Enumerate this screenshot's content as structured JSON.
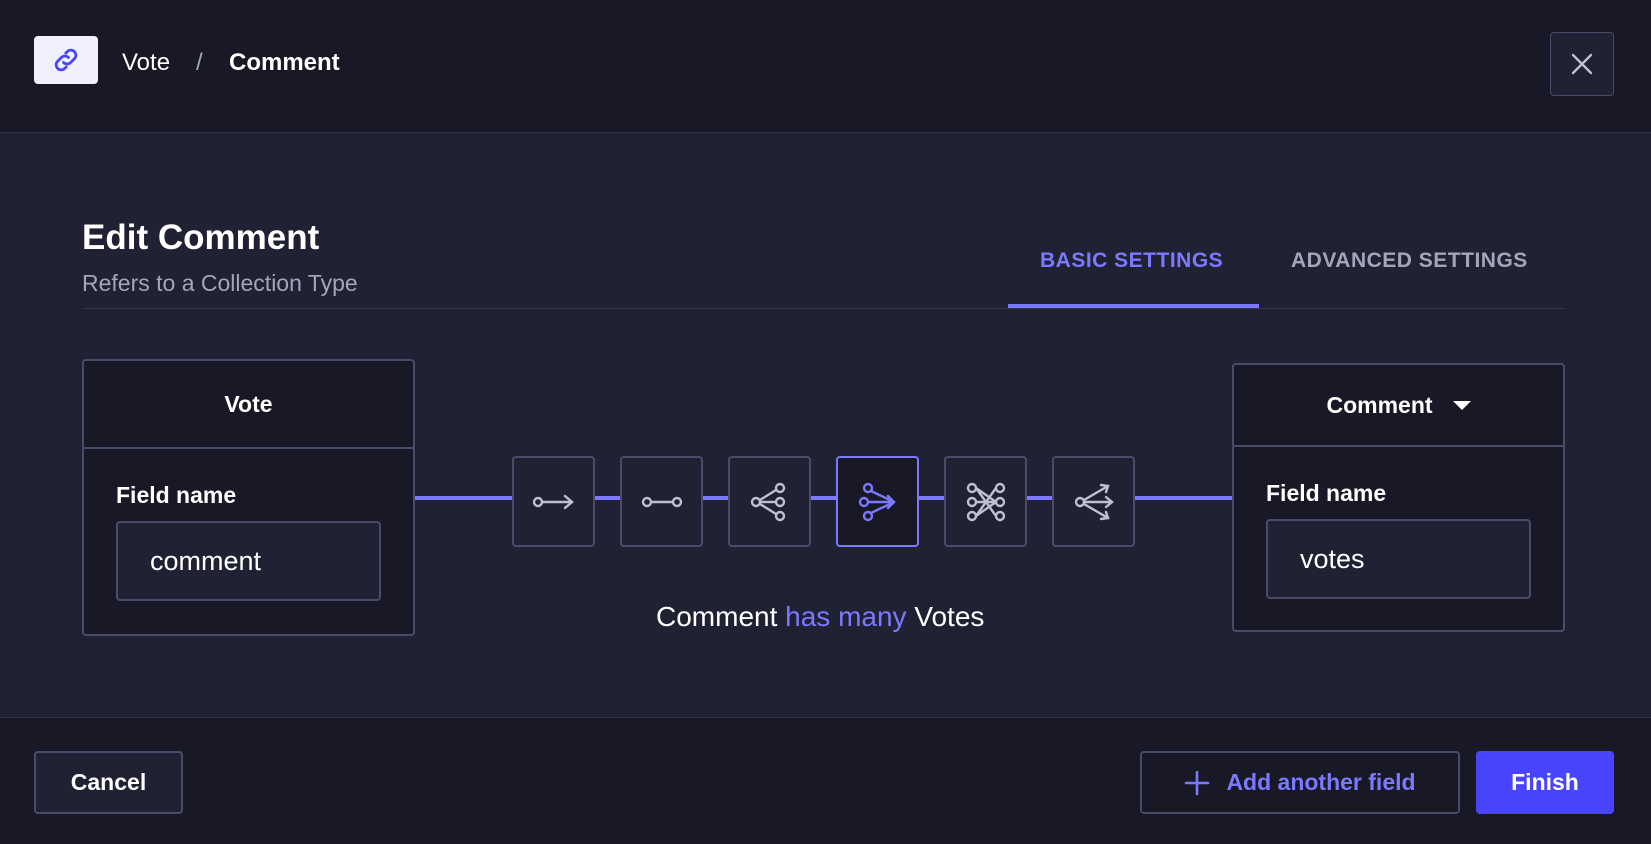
{
  "breadcrumb": {
    "source": "Vote",
    "separator": "/",
    "target": "Comment"
  },
  "header": {
    "link_icon": "link-icon",
    "close_icon": "close-icon"
  },
  "title": "Edit Comment",
  "subtitle": "Refers to a Collection Type",
  "tabs": [
    {
      "label": "BASIC SETTINGS",
      "active": true
    },
    {
      "label": "ADVANCED SETTINGS",
      "active": false
    }
  ],
  "left_card": {
    "header": "Vote",
    "field_label": "Field name",
    "field_value": "comment"
  },
  "right_card": {
    "header": "Comment",
    "field_label": "Field name",
    "field_value": "votes"
  },
  "relations": [
    {
      "icon": "one-way-icon",
      "active": false
    },
    {
      "icon": "one-to-one-icon",
      "active": false
    },
    {
      "icon": "one-to-many-icon",
      "active": false
    },
    {
      "icon": "many-to-one-icon",
      "active": true
    },
    {
      "icon": "many-to-many-icon",
      "active": false
    },
    {
      "icon": "many-way-icon",
      "active": false
    }
  ],
  "relation_text": {
    "subject": "Comment",
    "verb": "has many",
    "object": "Votes"
  },
  "footer": {
    "cancel_label": "Cancel",
    "add_field_label": "Add another field",
    "finish_label": "Finish"
  },
  "colors": {
    "accent": "#7b79ff",
    "primary": "#4945ff",
    "background": "#212134",
    "surface": "#181826",
    "border": "#4a4a6a"
  }
}
